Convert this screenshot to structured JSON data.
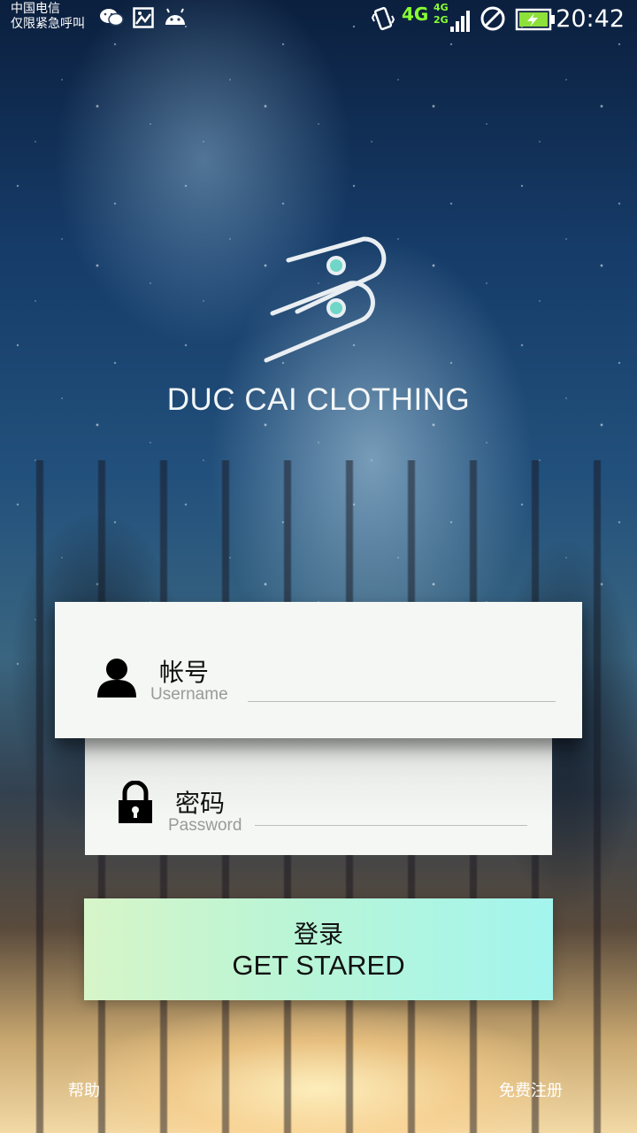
{
  "status_bar": {
    "carrier_line1": "中国电信",
    "carrier_line2": "仅限紧急呼叫",
    "network_main": "4G",
    "network_top": "4G",
    "network_bottom": "2G",
    "time": "20:42",
    "battery_color": "#8ee03a"
  },
  "brand": {
    "name": "DUC CAI CLOTHING",
    "logo_accent": "#6fd6c8"
  },
  "login_form": {
    "username": {
      "label_cn": "帐号",
      "placeholder": "Username",
      "value": ""
    },
    "password": {
      "label_cn": "密码",
      "placeholder": "Password",
      "value": ""
    }
  },
  "login_button": {
    "label_cn": "登录",
    "label_en": "GET STARED"
  },
  "footer": {
    "help": "帮助",
    "register": "免费注册"
  }
}
